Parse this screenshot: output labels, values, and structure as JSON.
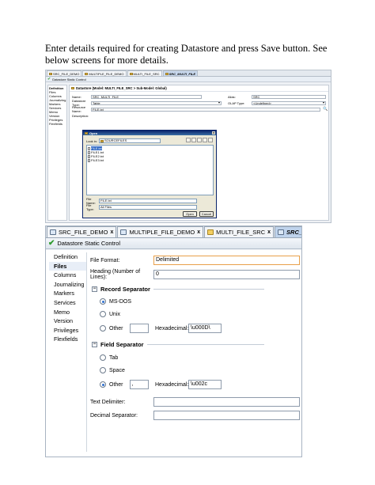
{
  "intro_text": "Enter details required for creating Datastore and press Save button. See below screens for more details.",
  "shot1": {
    "tabs": [
      "SRC_FILE_DEMO",
      "MULTIPLE_FILE_DEMO",
      "MULTI_FILE_SRC",
      "SRC_MULTI_FILE"
    ],
    "control_title": "Datastore Static Control",
    "nav": [
      "Definition",
      "Files",
      "Columns",
      "Journalizing",
      "Markers",
      "Services",
      "Memo",
      "Version",
      "Privileges",
      "Flexfields"
    ],
    "header": "Datastore (Model: MULTI_FILE_SRC > Sub-Model: Global)",
    "name_label": "Name:",
    "name_value": "SRC_MULTI_FILE",
    "alias_label": "Alias:",
    "alias_value": "SRC",
    "type_label": "Datastore Type:",
    "type_value": "Table",
    "olap_label": "OLAP Type:",
    "olap_value": "<Undefined>",
    "resource_label": "Resource Name:",
    "resource_value": "FILE.txt",
    "description_label": "Description:",
    "dialog": {
      "title": "Open",
      "look_in_label": "Look in:",
      "look_in_value": "SOURCEFILES",
      "files": [
        "FILE.txt",
        "FILE1.txt",
        "FILE2.txt",
        "FILE3.txt"
      ],
      "file_name_label": "File Name:",
      "file_name_value": "FILE.txt",
      "file_type_label": "File Type:",
      "file_type_value": "All Files",
      "open_button": "Open",
      "cancel_button": "Cancel"
    }
  },
  "shot2": {
    "tabs": [
      {
        "label": "SRC_FILE_DEMO",
        "close": "x"
      },
      {
        "label": "MULTIPLE_FILE_DEMO",
        "close": "x"
      },
      {
        "label": "MULTI_FILE_SRC",
        "close": "x"
      },
      {
        "label": "SRC_MULTI_FILE",
        "close": "x"
      }
    ],
    "control_title": "Datastore Static Control",
    "nav": [
      "Definition",
      "Files",
      "Columns",
      "Journalizing",
      "Markers",
      "Services",
      "Memo",
      "Version",
      "Privileges",
      "Flexfields"
    ],
    "file_format_label": "File Format:",
    "file_format_value": "Delimited",
    "heading_label": "Heading (Number of Lines):",
    "heading_value": "0",
    "record_sep_title": "Record Separator",
    "record_options": [
      "MS-DOS",
      "Unix",
      "Other"
    ],
    "record_hex_label": "Hexadecimal:",
    "record_hex_value": "\\u000D\\",
    "field_sep_title": "Field Separator",
    "field_options": [
      "Tab",
      "Space",
      "Other"
    ],
    "field_other_value": ",",
    "field_hex_label": "Hexadecimal:",
    "field_hex_value": "\\u002c",
    "text_delim_label": "Text Delimiter:",
    "decimal_sep_label": "Decimal Separator:"
  }
}
